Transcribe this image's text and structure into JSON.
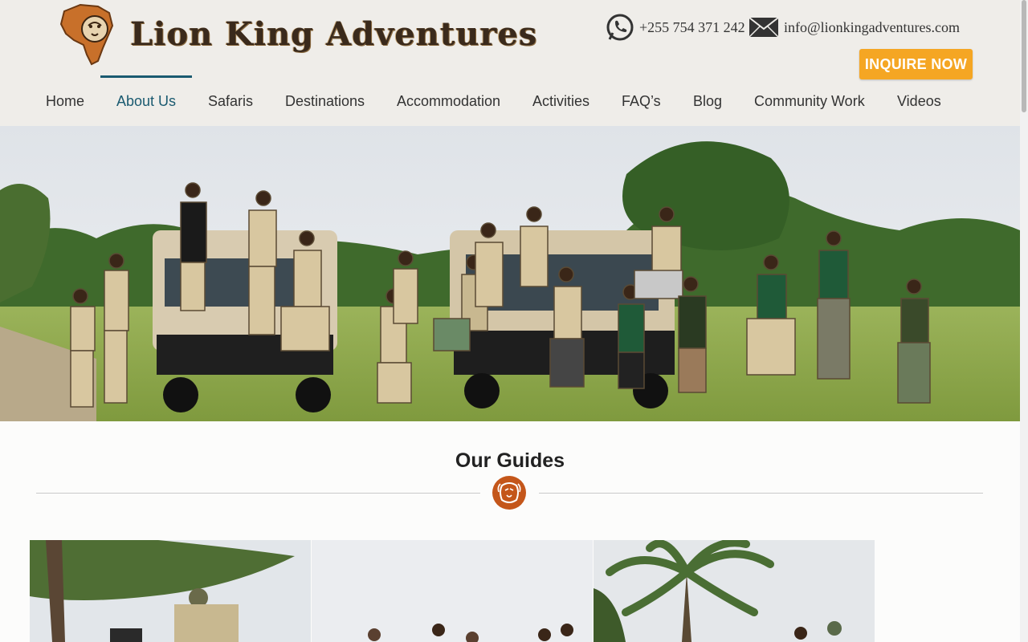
{
  "brand": {
    "name": "Lion King Adventures",
    "logo_icon": "lion-africa-logo-icon"
  },
  "contact": {
    "phone": "+255 754 371 242",
    "email": "info@lionkingadventures.com",
    "phone_icon": "whatsapp-icon",
    "email_icon": "envelope-icon"
  },
  "cta": {
    "inquire_label": "INQUIRE NOW"
  },
  "nav": {
    "items": [
      {
        "label": "Home"
      },
      {
        "label": "About Us",
        "active": true
      },
      {
        "label": "Safaris"
      },
      {
        "label": "Destinations"
      },
      {
        "label": "Accommodation"
      },
      {
        "label": "Activities"
      },
      {
        "label": "FAQ’s"
      },
      {
        "label": "Blog"
      },
      {
        "label": "Community Work"
      },
      {
        "label": "Videos"
      }
    ]
  },
  "section": {
    "title": "Our Guides",
    "divider_icon": "lion-head-icon"
  },
  "colors": {
    "accent_orange": "#f5a623",
    "nav_active": "#1a5a70",
    "badge_rust": "#c4561a",
    "header_bg": "#efede9"
  }
}
